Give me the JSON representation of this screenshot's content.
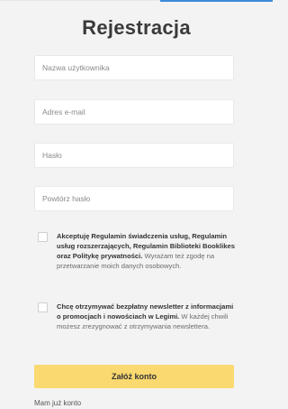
{
  "title": "Rejestracja",
  "fields": {
    "username_placeholder": "Nazwa użytkownika",
    "email_placeholder": "Adres e-mail",
    "password_placeholder": "Hasło",
    "repeat_password_placeholder": "Powtórz hasło"
  },
  "terms": {
    "bold": "Akceptuję Regulamin świadczenia usług, Regulamin usług rozszerzających, Regulamin Biblioteki Booklikes oraz Politykę prywatności.",
    "sub": "Wyrażam też zgodę na przetwarzanie moich danych osobowych."
  },
  "newsletter": {
    "bold": "Chcę otrzymywać bezpłatny newsletter z informacjami o promocjach i nowościach w Legimi.",
    "sub": "W każdej chwili możesz zrezygnować z otrzymywania newslettera."
  },
  "submit_label": "Załóż konto",
  "login_link": "Mam już konto",
  "colors": {
    "button": "#fad970",
    "background": "#f3f3f3",
    "accent": "#3b8ad9"
  }
}
